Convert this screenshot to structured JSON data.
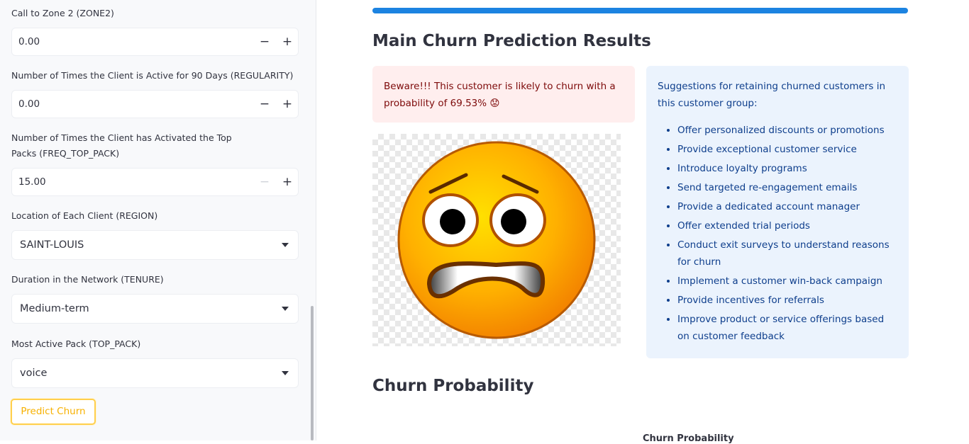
{
  "sidebar": {
    "zone2": {
      "label": "Call to Zone 2 (ZONE2)",
      "value": "0.00",
      "minus": "−",
      "plus": "+"
    },
    "regularity": {
      "label": "Number of Times the Client is Active for 90 Days (REGULARITY)",
      "value": "0.00",
      "minus": "−",
      "plus": "+"
    },
    "freq_top_pack": {
      "label": "Number of Times the Client has Activated the Top Packs (FREQ_TOP_PACK)",
      "value": "15.00",
      "minus": "−",
      "plus": "+"
    },
    "region": {
      "label": "Location of Each Client (REGION)",
      "value": "SAINT-LOUIS"
    },
    "tenure": {
      "label": "Duration in the Network (TENURE)",
      "value": "Medium-term"
    },
    "top_pack": {
      "label": "Most Active Pack (TOP_PACK)",
      "value": "voice"
    },
    "predict_button": "Predict Churn"
  },
  "main": {
    "results_title": "Main Churn Prediction Results",
    "warning": "Beware!!! This customer is likely to churn with a probability of 69.53% 😟",
    "image_icon": "worried-face-emoji",
    "suggestions_intro": "Suggestions for retaining churned customers in this customer group:",
    "suggestions": [
      "Offer personalized discounts or promotions",
      "Provide exceptional customer service",
      "Introduce loyalty programs",
      "Send targeted re-engagement emails",
      "Provide a dedicated account manager",
      "Offer extended trial periods",
      "Conduct exit surveys to understand reasons for churn",
      "Implement a customer win-back campaign",
      "Provide incentives for referrals",
      "Improve product or service offerings based on customer feedback"
    ],
    "probability_title": "Churn Probability",
    "chart_title_partial": "Churn Probability",
    "progress_fraction": 1.0
  },
  "colors": {
    "accent": "#1c83e1",
    "button": "#ffcf4d",
    "error_bg": "#ffeeee",
    "info_bg": "#ebf3fd"
  }
}
